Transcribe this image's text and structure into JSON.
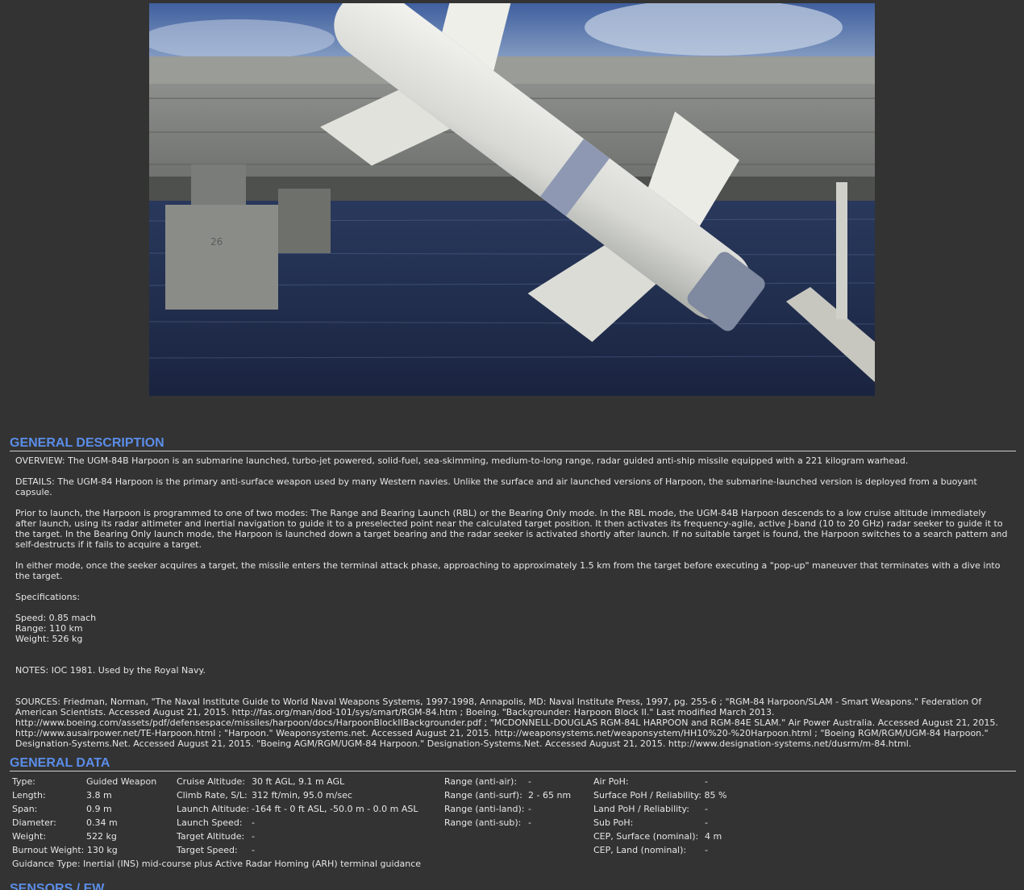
{
  "photo": {
    "alt_icon": "missile-photo",
    "pier_marking": "26"
  },
  "general_description": {
    "title": "GENERAL DESCRIPTION",
    "overview": "OVERVIEW: The UGM-84B Harpoon is an submarine launched, turbo-jet powered, solid-fuel, sea-skimming, medium-to-long range, radar guided anti-ship missile equipped with a 221 kilogram warhead.",
    "details": "DETAILS: The UGM-84 Harpoon is the primary anti-surface weapon used by many Western navies. Unlike the surface and air launched versions of Harpoon, the submarine-launched version is deployed from a buoyant capsule.",
    "prior": "Prior to launch, the Harpoon is programmed to one of two modes: The Range and Bearing Launch (RBL) or the Bearing Only mode. In the RBL mode, the UGM-84B Harpoon descends to a low cruise altitude immediately after launch, using its radar altimeter and inertial navigation to guide it to a preselected point near the calculated target position. It then activates its frequency-agile, active J-band (10 to 20 GHz) radar seeker to guide it to the target. In the Bearing Only launch mode, the Harpoon is launched down a target bearing and the radar seeker is activated shortly after launch. If no suitable target is found, the Harpoon switches to a search pattern and self-destructs if it fails to acquire a target.",
    "either": "In either mode, once the seeker acquires a target, the missile enters the terminal attack phase, approaching to approximately 1.5 km from the target before executing a \"pop-up\" maneuver that terminates with a dive into the target.",
    "specs_label": "Specifications:",
    "specs": "Speed: 0.85 mach\nRange: 110 km\nWeight: 526 kg",
    "notes": "NOTES: IOC 1981. Used by the Royal Navy.",
    "sources": "SOURCES: Friedman, Norman, \"The Naval Institute Guide to World Naval Weapons Systems, 1997-1998, Annapolis, MD: Naval Institute Press, 1997, pg. 255-6 ; \"RGM-84 Harpoon/SLAM - Smart Weapons.\" Federation Of American Scientists. Accessed August 21, 2015. http://fas.org/man/dod-101/sys/smart/RGM-84.htm ; Boeing. \"Backgrounder: Harpoon Block II.\" Last modified March 2013. http://www.boeing.com/assets/pdf/defensespace/missiles/harpoon/docs/HarpoonBlockIIBackgrounder.pdf ; \"MCDONNELL-DOUGLAS RGM-84L HARPOON and RGM-84E SLAM.\" Air Power Australia. Accessed August 21, 2015. http://www.ausairpower.net/TE-Harpoon.html ; \"Harpoon.\" Weaponsystems.net. Accessed August 21, 2015. http://weaponsystems.net/weaponsystem/HH10%20-%20Harpoon.html ; \"Boeing RGM/RGM/UGM-84 Harpoon.\" Designation-Systems.Net. Accessed August 21, 2015. \"Boeing AGM/RGM/UGM-84 Harpoon.\" Designation-Systems.Net. Accessed August 21, 2015. http://www.designation-systems.net/dusrm/m-84.html."
  },
  "general_data": {
    "title": "GENERAL DATA",
    "col1": [
      {
        "k": "Type:",
        "v": "Guided Weapon"
      },
      {
        "k": "Length:",
        "v": "3.8 m"
      },
      {
        "k": "Span:",
        "v": "0.9 m"
      },
      {
        "k": "Diameter:",
        "v": "0.34 m"
      },
      {
        "k": "Weight:",
        "v": "522 kg"
      },
      {
        "k": "Burnout Weight:",
        "v": "130 kg"
      }
    ],
    "guidance": {
      "k": "Guidance Type:",
      "v": "Inertial (INS) mid-course plus Active Radar Homing (ARH) terminal guidance"
    },
    "col2": [
      {
        "k": "Cruise Altitude:",
        "v": "30 ft AGL, 9.1 m AGL"
      },
      {
        "k": "Climb Rate, S/L:",
        "v": "312 ft/min, 95.0 m/sec"
      },
      {
        "k": "Launch Altitude:",
        "v": "-164 ft - 0 ft ASL, -50.0 m - 0.0 m ASL"
      },
      {
        "k": "Launch Speed:",
        "v": "-"
      },
      {
        "k": "Target Altitude:",
        "v": "-"
      },
      {
        "k": "Target Speed:",
        "v": "-"
      }
    ],
    "col3": [
      {
        "k": "Range (anti-air):",
        "v": "-"
      },
      {
        "k": "Range (anti-surf):",
        "v": "2 - 65 nm"
      },
      {
        "k": "Range (anti-land):",
        "v": "-"
      },
      {
        "k": "Range (anti-sub):",
        "v": "-"
      }
    ],
    "col4": [
      {
        "k": "Air PoH:",
        "v": "-"
      },
      {
        "k": "Surface PoH / Reliability:",
        "v": "85 %"
      },
      {
        "k": "Land PoH / Reliability:",
        "v": "-"
      },
      {
        "k": "Sub PoH:",
        "v": "-"
      },
      {
        "k": "CEP, Surface (nominal):",
        "v": "4 m"
      },
      {
        "k": "CEP, Land (nominal):",
        "v": "-"
      }
    ]
  },
  "sensors": {
    "title": "SENSORS / EW"
  }
}
